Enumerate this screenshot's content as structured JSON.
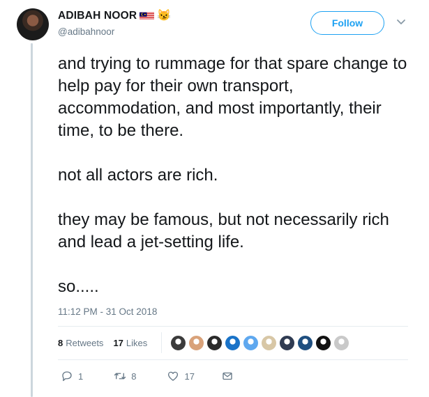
{
  "header": {
    "name": "ADIBAH NOOR",
    "handle": "@adibahnoor",
    "follow_label": "Follow",
    "emoji_cat": "😼"
  },
  "tweet": {
    "paragraphs": [
      "and trying to rummage for that spare change to help pay for their own transport, accommodation, and most importantly, their time, to be there.",
      "not all actors are rich.",
      "they may be famous, but not necessarily rich and lead a jet-setting life.",
      "so....."
    ],
    "timestamp": "11:12 PM - 31 Oct 2018"
  },
  "stats": {
    "retweets_count": "8",
    "retweets_label": "Retweets",
    "likes_count": "17",
    "likes_label": "Likes",
    "liker_avatar_colors": [
      "#3b3b3b",
      "#d9a27a",
      "#2b2b2b",
      "#1a73c8",
      "#5fa8ef",
      "#d8c7a6",
      "#2f3b52",
      "#1f4f80",
      "#111111",
      "#c9c9c9"
    ]
  },
  "actions": {
    "replies": "1",
    "retweets": "8",
    "likes": "17"
  },
  "colors": {
    "accent": "#1da1f2",
    "muted": "#657786",
    "text": "#14171a"
  }
}
